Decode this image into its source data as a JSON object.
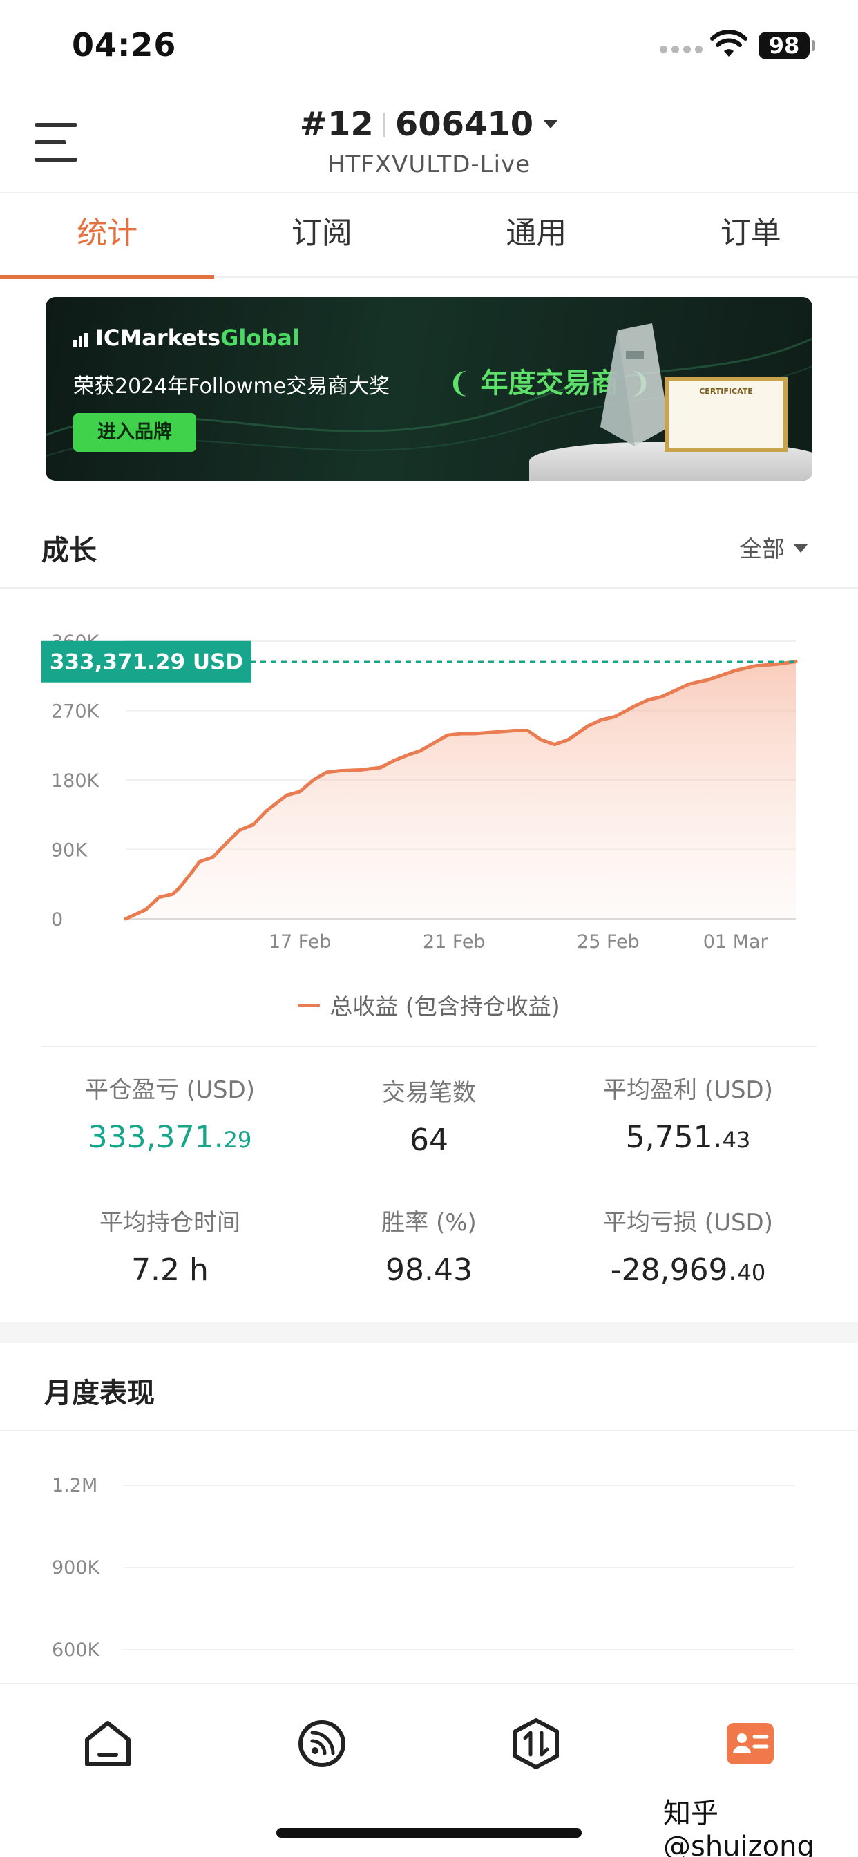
{
  "status_bar": {
    "time": "04:26",
    "battery": "98"
  },
  "header": {
    "rank": "#12",
    "account_number": "606410",
    "server": "HTFXVULTD-Live"
  },
  "tabs": [
    {
      "label": "统计",
      "active": true
    },
    {
      "label": "订阅",
      "active": false
    },
    {
      "label": "通用",
      "active": false
    },
    {
      "label": "订单",
      "active": false
    }
  ],
  "banner": {
    "logo_ic": "IC",
    "logo_markets": "Markets",
    "logo_global": "Global",
    "headline": "荣获2024年Followme交易商大奖",
    "award": "年度交易商",
    "cta": "进入品牌",
    "certificate": "CERTIFICATE"
  },
  "growth": {
    "title": "成长",
    "range": "全部",
    "legend": "总收益 (包含持仓收益)",
    "current_value_label": "333,371.29 USD"
  },
  "chart_data": {
    "type": "area",
    "ylim": [
      0,
      360000
    ],
    "yticks": [
      "0",
      "90K",
      "180K",
      "270K",
      "360K"
    ],
    "ytick_values": [
      0,
      90000,
      180000,
      270000,
      360000
    ],
    "xticks": [
      "17 Feb",
      "21 Feb",
      "25 Feb",
      "01 Mar"
    ],
    "xtick_positions": [
      0.26,
      0.49,
      0.72,
      0.91
    ],
    "series": [
      {
        "name": "总收益 (包含持仓收益)",
        "color": "#ea7c52",
        "x": [
          0,
          0.03,
          0.05,
          0.07,
          0.08,
          0.1,
          0.11,
          0.13,
          0.15,
          0.17,
          0.19,
          0.21,
          0.24,
          0.26,
          0.28,
          0.3,
          0.32,
          0.35,
          0.38,
          0.4,
          0.42,
          0.44,
          0.46,
          0.48,
          0.5,
          0.52,
          0.55,
          0.58,
          0.6,
          0.62,
          0.64,
          0.66,
          0.69,
          0.71,
          0.73,
          0.76,
          0.78,
          0.8,
          0.82,
          0.84,
          0.87,
          0.89,
          0.91,
          0.94,
          0.97,
          1.0
        ],
        "y": [
          0,
          12000,
          28000,
          32000,
          40000,
          62000,
          74000,
          80000,
          98000,
          115000,
          122000,
          140000,
          160000,
          165000,
          180000,
          190000,
          192000,
          193000,
          196000,
          205000,
          212000,
          218000,
          228000,
          238000,
          240000,
          240000,
          242000,
          244000,
          244000,
          232000,
          226000,
          232000,
          250000,
          258000,
          262000,
          276000,
          284000,
          288000,
          296000,
          304000,
          310000,
          316000,
          322000,
          328000,
          330000,
          333371
        ]
      }
    ],
    "grid": true
  },
  "stats": [
    {
      "label": "平仓盈亏 (USD)",
      "int": "333,371.",
      "dec": "29",
      "green": true
    },
    {
      "label": "交易笔数",
      "int": "64",
      "dec": "",
      "green": false
    },
    {
      "label": "平均盈利 (USD)",
      "int": "5,751.",
      "dec": "43",
      "green": false
    },
    {
      "label": "平均持仓时间",
      "int": "7.2 h",
      "dec": "",
      "green": false
    },
    {
      "label": "胜率 (%)",
      "int": "98.43",
      "dec": "",
      "green": false
    },
    {
      "label": "平均亏损 (USD)",
      "int": "-28,969.",
      "dec": "40",
      "green": false
    }
  ],
  "monthly": {
    "title": "月度表现",
    "yticks": [
      "1.2M",
      "900K",
      "600K"
    ]
  },
  "tabbar": {
    "items": [
      "home-icon",
      "feed-icon",
      "trade-icon",
      "profile-card-icon"
    ],
    "active": "profile-card-icon",
    "accent": "#f0784a"
  },
  "watermark": "知乎 @shuizong"
}
